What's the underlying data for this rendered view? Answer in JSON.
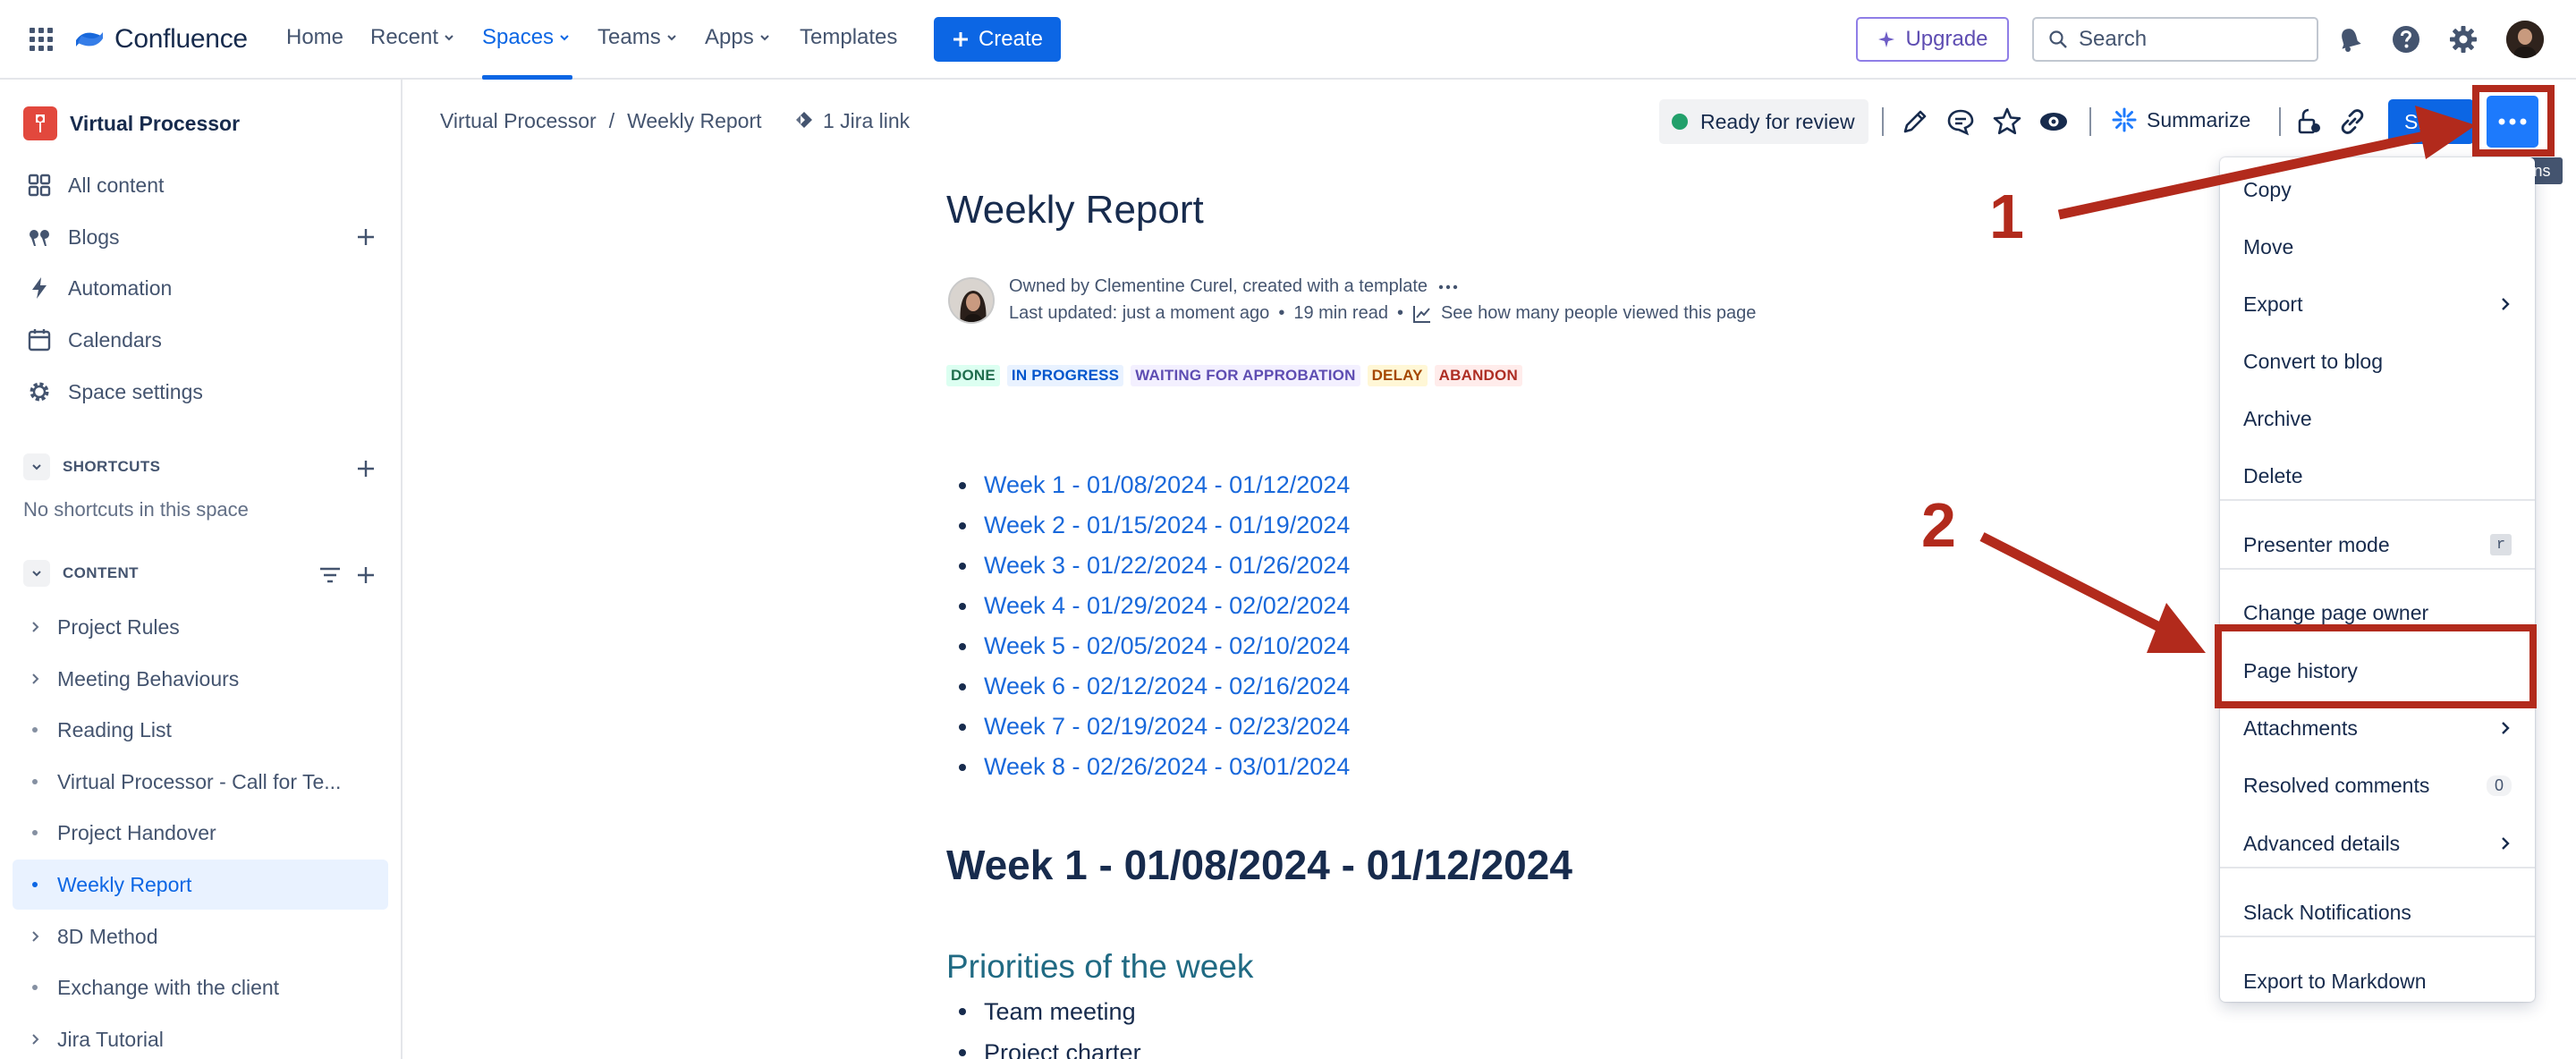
{
  "topnav": {
    "brand": "Confluence",
    "items": [
      {
        "label": "Home",
        "dropdown": false
      },
      {
        "label": "Recent",
        "dropdown": true
      },
      {
        "label": "Spaces",
        "dropdown": true,
        "active": true
      },
      {
        "label": "Teams",
        "dropdown": true
      },
      {
        "label": "Apps",
        "dropdown": true
      },
      {
        "label": "Templates",
        "dropdown": false
      }
    ],
    "create_label": "Create",
    "upgrade_label": "Upgrade",
    "search_placeholder": "Search",
    "icons": [
      "app-switcher-icon",
      "notifications-icon",
      "help-icon",
      "settings-icon",
      "avatar"
    ]
  },
  "sidebar": {
    "space_name": "Virtual Processor",
    "items": [
      {
        "label": "All content",
        "icon": "grid-icon"
      },
      {
        "label": "Blogs",
        "icon": "quote-icon",
        "add": true
      },
      {
        "label": "Automation",
        "icon": "lightning-icon"
      },
      {
        "label": "Calendars",
        "icon": "calendar-icon"
      },
      {
        "label": "Space settings",
        "icon": "gear-icon"
      }
    ],
    "shortcuts_header": "SHORTCUTS",
    "no_shortcuts": "No shortcuts in this space",
    "content_header": "CONTENT",
    "tree": [
      {
        "label": "Project Rules",
        "expandable": true
      },
      {
        "label": "Meeting Behaviours",
        "expandable": true
      },
      {
        "label": "Reading List",
        "expandable": false
      },
      {
        "label": "Virtual Processor - Call for Te...",
        "expandable": false
      },
      {
        "label": "Project Handover",
        "expandable": false
      },
      {
        "label": "Weekly Report",
        "expandable": false,
        "selected": true
      },
      {
        "label": "8D Method",
        "expandable": true
      },
      {
        "label": "Exchange with the client",
        "expandable": false
      },
      {
        "label": "Jira Tutorial",
        "expandable": true
      }
    ]
  },
  "header": {
    "breadcrumb": [
      "Virtual Processor",
      "/",
      "Weekly Report"
    ],
    "jira_link": "1 Jira link",
    "status": "Ready for review",
    "summarize_label": "Summarize",
    "share_label": "Sh",
    "more_tooltip": "More actions"
  },
  "page": {
    "title": "Weekly Report",
    "byline_owner": "Owned by Clementine Curel, created with a template",
    "byline_updated": "Last updated: just a moment ago",
    "read_time": "19 min read",
    "views_link": "See how many people viewed this page",
    "lozenges": [
      "DONE",
      "IN PROGRESS",
      "WAITING FOR APPROBATION",
      "DELAY",
      "ABANDON"
    ],
    "weeks": [
      "Week 1 - 01/08/2024 - 01/12/2024",
      "Week 2 - 01/15/2024 - 01/19/2024",
      "Week 3 - 01/22/2024 - 01/26/2024",
      "Week 4 - 01/29/2024 - 02/02/2024",
      "Week 5 - 02/05/2024 - 02/10/2024",
      "Week 6 - 02/12/2024 - 02/16/2024",
      "Week 7 - 02/19/2024 - 02/23/2024",
      "Week 8 - 02/26/2024 - 03/01/2024"
    ],
    "week1_heading": "Week 1 - 01/08/2024 - 01/12/2024",
    "priorities_heading": "Priorities of the week",
    "priorities": [
      "Team meeting",
      "Project charter"
    ]
  },
  "menu": {
    "items": [
      {
        "label": "Copy"
      },
      {
        "label": "Move"
      },
      {
        "label": "Export",
        "submenu": true
      },
      {
        "label": "Convert to blog"
      },
      {
        "label": "Archive"
      },
      {
        "label": "Delete"
      },
      {
        "label": "Presenter mode",
        "shortcut": "r"
      },
      {
        "label": "Change page owner"
      },
      {
        "label": "Page history",
        "highlighted": true
      },
      {
        "label": "Attachments",
        "submenu": true
      },
      {
        "label": "Resolved comments",
        "count": "0"
      },
      {
        "label": "Advanced details",
        "submenu": true
      },
      {
        "label": "Slack Notifications"
      },
      {
        "label": "Export to Markdown"
      }
    ]
  },
  "annotations": {
    "step1": "1",
    "step2": "2",
    "color": "#b22a1c"
  }
}
